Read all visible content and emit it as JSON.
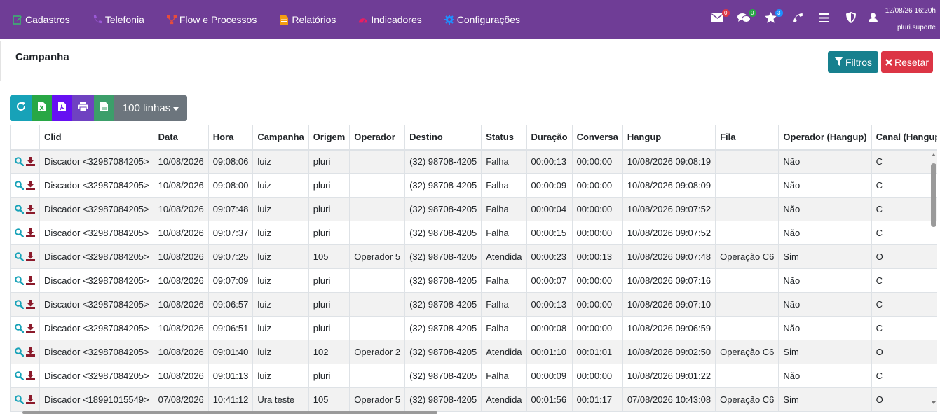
{
  "nav": {
    "items": [
      {
        "label": "Cadastros",
        "icon": "edit-icon",
        "color": "#3cb371"
      },
      {
        "label": "Telefonia",
        "icon": "phone-icon",
        "color": "#9b59d6"
      },
      {
        "label": "Flow e Processos",
        "icon": "sitemap-icon",
        "color": "#e74c3c"
      },
      {
        "label": "Relatórios",
        "icon": "file-icon",
        "color": "#f39c12"
      },
      {
        "label": "Indicadores",
        "icon": "gauge-icon",
        "color": "#e91e63"
      },
      {
        "label": "Configurações",
        "icon": "gear-icon",
        "color": "#1e90ff"
      }
    ],
    "badges": {
      "mail": "0",
      "chat": "0",
      "star": "3"
    },
    "datetime": "12/08/26 16:20h",
    "username": "pluri.suporte"
  },
  "header": {
    "title": "Campanha",
    "filtros_label": "Filtros",
    "resetar_label": "Resetar"
  },
  "toolbar": {
    "lines_label": "100 linhas"
  },
  "table": {
    "columns": [
      "",
      "Clid",
      "Data",
      "Hora",
      "Campanha",
      "Origem",
      "Operador",
      "Destino",
      "Status",
      "Duração",
      "Conversa",
      "Hangup",
      "Fila",
      "Operador (Hangup)",
      "Canal (Hangup)"
    ],
    "rows": [
      [
        "Discador <32987084205>",
        "10/08/2026",
        "09:08:06",
        "luiz",
        "pluri",
        "",
        "(32) 98708-4205",
        "Falha",
        "00:00:13",
        "00:00:00",
        "10/08/2026 09:08:19",
        "",
        "Não",
        "C"
      ],
      [
        "Discador <32987084205>",
        "10/08/2026",
        "09:08:00",
        "luiz",
        "pluri",
        "",
        "(32) 98708-4205",
        "Falha",
        "00:00:09",
        "00:00:00",
        "10/08/2026 09:08:09",
        "",
        "Não",
        "C"
      ],
      [
        "Discador <32987084205>",
        "10/08/2026",
        "09:07:48",
        "luiz",
        "pluri",
        "",
        "(32) 98708-4205",
        "Falha",
        "00:00:04",
        "00:00:00",
        "10/08/2026 09:07:52",
        "",
        "Não",
        "C"
      ],
      [
        "Discador <32987084205>",
        "10/08/2026",
        "09:07:37",
        "luiz",
        "pluri",
        "",
        "(32) 98708-4205",
        "Falha",
        "00:00:15",
        "00:00:00",
        "10/08/2026 09:07:52",
        "",
        "Não",
        "C"
      ],
      [
        "Discador <32987084205>",
        "10/08/2026",
        "09:07:25",
        "luiz",
        "105",
        "Operador 5",
        "(32) 98708-4205",
        "Atendida",
        "00:00:23",
        "00:00:13",
        "10/08/2026 09:07:48",
        "Operação C6",
        "Sim",
        "O"
      ],
      [
        "Discador <32987084205>",
        "10/08/2026",
        "09:07:09",
        "luiz",
        "pluri",
        "",
        "(32) 98708-4205",
        "Falha",
        "00:00:07",
        "00:00:00",
        "10/08/2026 09:07:16",
        "",
        "Não",
        "C"
      ],
      [
        "Discador <32987084205>",
        "10/08/2026",
        "09:06:57",
        "luiz",
        "pluri",
        "",
        "(32) 98708-4205",
        "Falha",
        "00:00:13",
        "00:00:00",
        "10/08/2026 09:07:10",
        "",
        "Não",
        "C"
      ],
      [
        "Discador <32987084205>",
        "10/08/2026",
        "09:06:51",
        "luiz",
        "pluri",
        "",
        "(32) 98708-4205",
        "Falha",
        "00:00:08",
        "00:00:00",
        "10/08/2026 09:06:59",
        "",
        "Não",
        "C"
      ],
      [
        "Discador <32987084205>",
        "10/08/2026",
        "09:01:40",
        "luiz",
        "102",
        "Operador 2",
        "(32) 98708-4205",
        "Atendida",
        "00:01:10",
        "00:01:01",
        "10/08/2026 09:02:50",
        "Operação C6",
        "Sim",
        "O"
      ],
      [
        "Discador <32987084205>",
        "10/08/2026",
        "09:01:13",
        "luiz",
        "pluri",
        "",
        "(32) 98708-4205",
        "Falha",
        "00:00:09",
        "00:00:00",
        "10/08/2026 09:01:22",
        "",
        "Não",
        "C"
      ],
      [
        "Discador <18991015549>",
        "07/08/2026",
        "10:41:12",
        "Ura teste",
        "105",
        "Operador 5",
        "(32) 98708-4205",
        "Atendida",
        "00:01:56",
        "00:01:17",
        "07/08/2026 10:43:08",
        "Operação C6",
        "Sim",
        "O"
      ]
    ]
  }
}
